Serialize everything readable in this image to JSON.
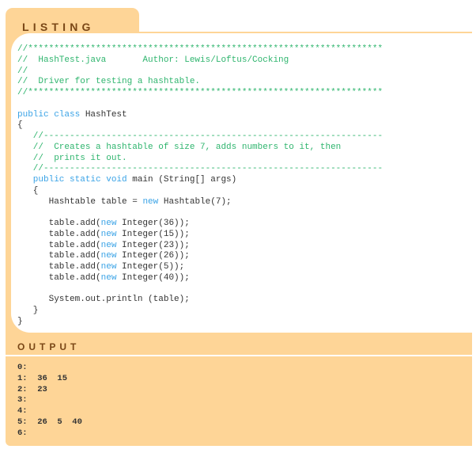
{
  "listing_title": "LISTING 10.8",
  "output_title": "OUTPUT",
  "colors": {
    "frame": "#fed597",
    "label": "#7a4716",
    "comment": "#2fb56e",
    "keyword": "#3aa3e6",
    "text": "#333333"
  },
  "code_lines": [
    [
      [
        "c",
        "//********************************************************************"
      ]
    ],
    [
      [
        "c",
        "//  HashTest.java       Author: Lewis/Loftus/Cocking"
      ]
    ],
    [
      [
        "c",
        "//"
      ]
    ],
    [
      [
        "c",
        "//  Driver for testing a hashtable."
      ]
    ],
    [
      [
        "c",
        "//********************************************************************"
      ]
    ],
    [],
    [
      [
        "k",
        "public class "
      ],
      [
        "t",
        "HashTest"
      ]
    ],
    [
      [
        "t",
        "{"
      ]
    ],
    [
      [
        "c",
        "   //-----------------------------------------------------------------"
      ]
    ],
    [
      [
        "c",
        "   //  Creates a hashtable of size 7, adds numbers to it, then"
      ]
    ],
    [
      [
        "c",
        "   //  prints it out."
      ]
    ],
    [
      [
        "c",
        "   //-----------------------------------------------------------------"
      ]
    ],
    [
      [
        "k",
        "   public static void "
      ],
      [
        "t",
        "main (String[] args)"
      ]
    ],
    [
      [
        "t",
        "   {"
      ]
    ],
    [
      [
        "t",
        "      Hashtable table = "
      ],
      [
        "k",
        "new "
      ],
      [
        "t",
        "Hashtable(7);"
      ]
    ],
    [],
    [
      [
        "t",
        "      table.add("
      ],
      [
        "k",
        "new "
      ],
      [
        "t",
        "Integer(36));"
      ]
    ],
    [
      [
        "t",
        "      table.add("
      ],
      [
        "k",
        "new "
      ],
      [
        "t",
        "Integer(15));"
      ]
    ],
    [
      [
        "t",
        "      table.add("
      ],
      [
        "k",
        "new "
      ],
      [
        "t",
        "Integer(23));"
      ]
    ],
    [
      [
        "t",
        "      table.add("
      ],
      [
        "k",
        "new "
      ],
      [
        "t",
        "Integer(26));"
      ]
    ],
    [
      [
        "t",
        "      table.add("
      ],
      [
        "k",
        "new "
      ],
      [
        "t",
        "Integer(5));"
      ]
    ],
    [
      [
        "t",
        "      table.add("
      ],
      [
        "k",
        "new "
      ],
      [
        "t",
        "Integer(40));"
      ]
    ],
    [],
    [
      [
        "t",
        "      System.out.println (table);"
      ]
    ],
    [
      [
        "t",
        "   }"
      ]
    ],
    [
      [
        "t",
        "}"
      ]
    ]
  ],
  "output_lines": [
    "0:",
    "1:  36  15",
    "2:  23",
    "3:",
    "4:",
    "5:  26  5  40",
    "6:"
  ]
}
